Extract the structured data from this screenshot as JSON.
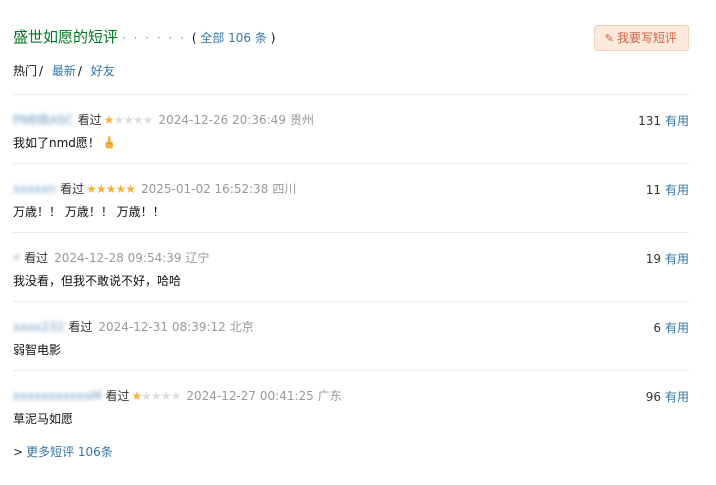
{
  "header": {
    "title": "盛世如愿的短评",
    "dots": "· · · · · ·",
    "all_open": "(",
    "all_label": "全部 106 条",
    "all_close": ")",
    "write_button": "我要写短评"
  },
  "tabs": [
    {
      "label": "热门",
      "sep": "/"
    },
    {
      "label": "最新",
      "sep": "/"
    },
    {
      "label": "好友",
      "sep": ""
    }
  ],
  "comments": [
    {
      "user": "PNB铁ASC",
      "status": "看过",
      "rating": 1,
      "time": "2024-12-26 20:36:49",
      "location": "贵州",
      "votes": "131",
      "useful": "有用",
      "content": "我如了nmd愿！",
      "hand_icon": "pointing-hand-icon"
    },
    {
      "user": "xxxxxn",
      "status": "看过",
      "rating": 5,
      "time": "2025-01-02 16:52:38",
      "location": "四川",
      "votes": "11",
      "useful": "有用",
      "content": "万歳！！ 万歳！！ 万歳！！"
    },
    {
      "user": "•",
      "status": "看过",
      "rating": 0,
      "time": "2024-12-28 09:54:39",
      "location": "辽宁",
      "votes": "19",
      "useful": "有用",
      "content": "我没看，但我不敢说不好，哈哈"
    },
    {
      "user": "xxxx232",
      "status": "看过",
      "rating": 0,
      "time": "2024-12-31 08:39:12",
      "location": "北京",
      "votes": "6",
      "useful": "有用",
      "content": "弱智电影"
    },
    {
      "user": "xxxxxxxxxxxM",
      "status": "看过",
      "rating": 1,
      "time": "2024-12-27 00:41:25",
      "location": "广东",
      "votes": "96",
      "useful": "有用",
      "content": "草泥马如愿"
    }
  ],
  "more": {
    "arrow": ">",
    "label": "更多短评 106条"
  },
  "colors": {
    "title": "#007722",
    "link": "#3377aa",
    "star": "#f6b23b",
    "button_bg": "#fbe9dc",
    "button_text": "#ca6445"
  }
}
